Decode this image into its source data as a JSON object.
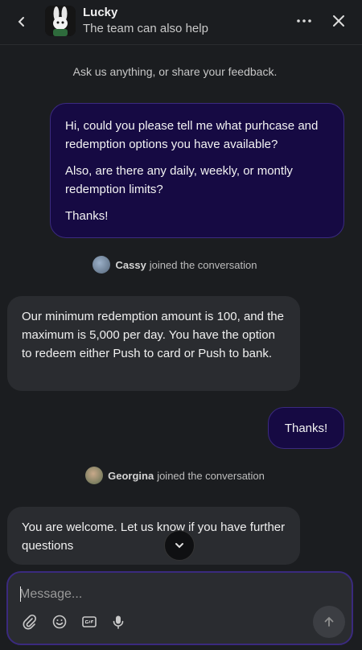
{
  "header": {
    "title": "Lucky",
    "subtitle": "The team can also help"
  },
  "conversation": {
    "intro": "Ask us anything, or share your feedback.",
    "user_message": {
      "line1": "Hi, could you please tell me what purhcase and redemption options you have available?",
      "line2": "Also, are there any daily, weekly, or montly redemption limits?",
      "line3": "Thanks!"
    },
    "join1": {
      "name": "Cassy",
      "text": "joined the conversation"
    },
    "agent_message1": "Our minimum redemption amount is 100, and the maximum is 5,000 per day. You have the option to redeem either Push to card or Push to bank.",
    "user_message2": "Thanks!",
    "join2": {
      "name": "Georgina",
      "text": "joined the conversation"
    },
    "agent_message2": "You are welcome. Let us know if you have further questions"
  },
  "composer": {
    "placeholder": "Message..."
  },
  "colors": {
    "background": "#1b1d20",
    "user_bubble": "#160a43",
    "agent_bubble": "#2a2c30",
    "accent_border": "#3b2a80"
  }
}
